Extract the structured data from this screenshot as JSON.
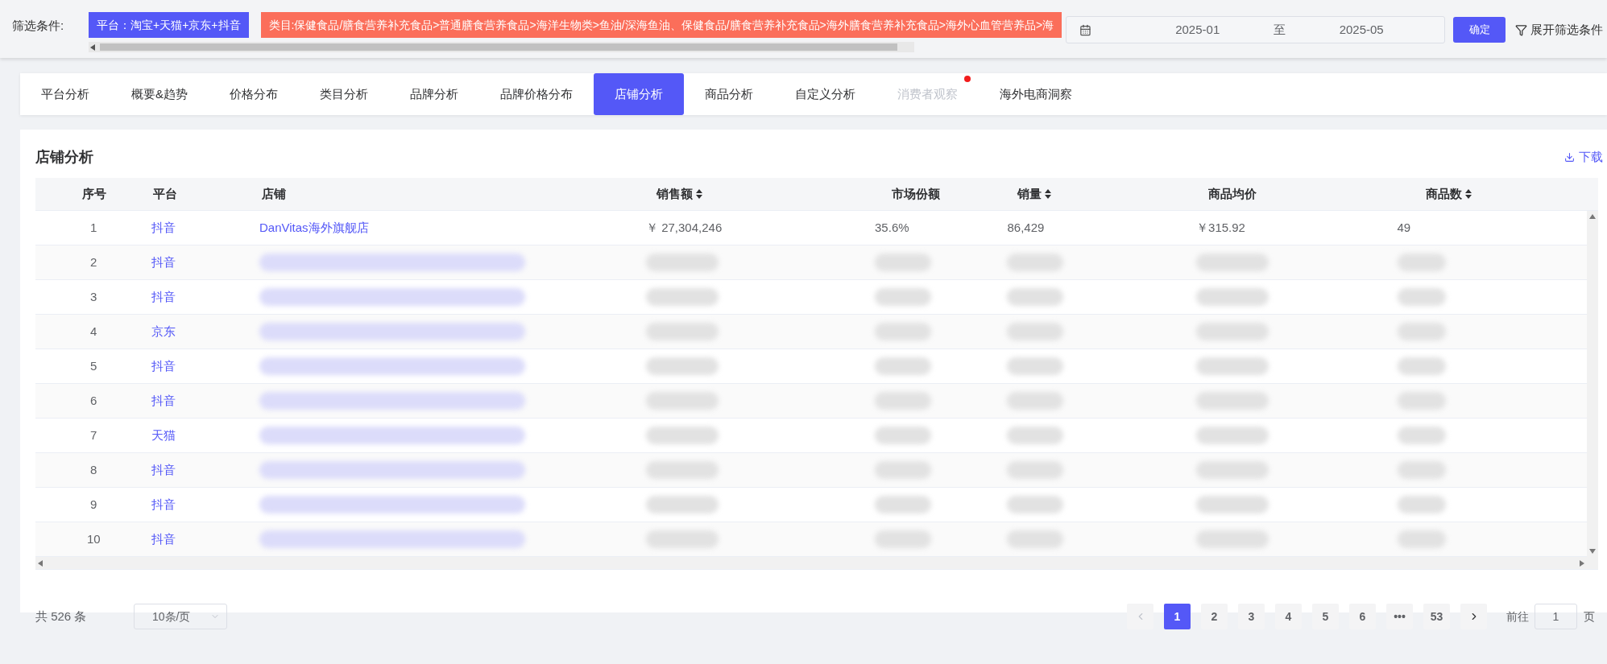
{
  "filter_bar": {
    "label": "筛选条件:",
    "tags": [
      {
        "kind": "platform",
        "text": "平台：淘宝+天猫+京东+抖音"
      },
      {
        "kind": "category",
        "text": "类目:保健食品/膳食营养补充食品>普通膳食营养食品>海洋生物类>鱼油/深海鱼油、保健食品/膳食营养补充食品>海外膳食营养补充食品>海外心血管营养品>海"
      }
    ],
    "date_range": {
      "start": "2025-01",
      "separator": "至",
      "end": "2025-05"
    },
    "confirm_button": "确定",
    "expand_button": "展开筛选条件"
  },
  "tabs": [
    {
      "label": "平台分析",
      "selected": false,
      "disabled": false,
      "dot": false
    },
    {
      "label": "概要&趋势",
      "selected": false,
      "disabled": false,
      "dot": false
    },
    {
      "label": "价格分布",
      "selected": false,
      "disabled": false,
      "dot": false
    },
    {
      "label": "类目分析",
      "selected": false,
      "disabled": false,
      "dot": false
    },
    {
      "label": "品牌分析",
      "selected": false,
      "disabled": false,
      "dot": false
    },
    {
      "label": "品牌价格分布",
      "selected": false,
      "disabled": false,
      "dot": false
    },
    {
      "label": "店铺分析",
      "selected": true,
      "disabled": false,
      "dot": false
    },
    {
      "label": "商品分析",
      "selected": false,
      "disabled": false,
      "dot": false
    },
    {
      "label": "自定义分析",
      "selected": false,
      "disabled": false,
      "dot": false
    },
    {
      "label": "消费者观察",
      "selected": false,
      "disabled": true,
      "dot": true
    },
    {
      "label": "海外电商洞察",
      "selected": false,
      "disabled": false,
      "dot": false
    }
  ],
  "panel": {
    "title": "店铺分析",
    "download": "下载",
    "table": {
      "columns": [
        {
          "label": "序号",
          "sortable": false
        },
        {
          "label": "平台",
          "sortable": false
        },
        {
          "label": "店铺",
          "sortable": false
        },
        {
          "label": "销售额",
          "sortable": true
        },
        {
          "label": "市场份额",
          "sortable": false
        },
        {
          "label": "销量",
          "sortable": true
        },
        {
          "label": "商品均价",
          "sortable": false
        },
        {
          "label": "商品数",
          "sortable": true
        }
      ],
      "rows": [
        {
          "index": "1",
          "platform": "抖音",
          "redacted": false,
          "shop": "DanVitas海外旗舰店",
          "sales": "￥ 27,304,246",
          "share": "35.6%",
          "volume": "86,429",
          "avg_price": "￥315.92",
          "count": "49"
        },
        {
          "index": "2",
          "platform": "抖音",
          "redacted": true
        },
        {
          "index": "3",
          "platform": "抖音",
          "redacted": true
        },
        {
          "index": "4",
          "platform": "京东",
          "redacted": true
        },
        {
          "index": "5",
          "platform": "抖音",
          "redacted": true
        },
        {
          "index": "6",
          "platform": "抖音",
          "redacted": true
        },
        {
          "index": "7",
          "platform": "天猫",
          "redacted": true
        },
        {
          "index": "8",
          "platform": "抖音",
          "redacted": true
        },
        {
          "index": "9",
          "platform": "抖音",
          "redacted": true
        },
        {
          "index": "10",
          "platform": "抖音",
          "redacted": true
        }
      ]
    }
  },
  "pagination": {
    "total": "共 526 条",
    "page_size": "10条/页",
    "pages": [
      {
        "label": "1",
        "selected": true
      },
      {
        "label": "2",
        "selected": false
      },
      {
        "label": "3",
        "selected": false
      },
      {
        "label": "4",
        "selected": false
      },
      {
        "label": "5",
        "selected": false
      },
      {
        "label": "6",
        "selected": false
      },
      {
        "label": "•••",
        "selected": false
      },
      {
        "label": "53",
        "selected": false
      }
    ],
    "prev_disabled": true,
    "goto_label": "前往",
    "goto_value": "1",
    "goto_suffix": "页"
  }
}
